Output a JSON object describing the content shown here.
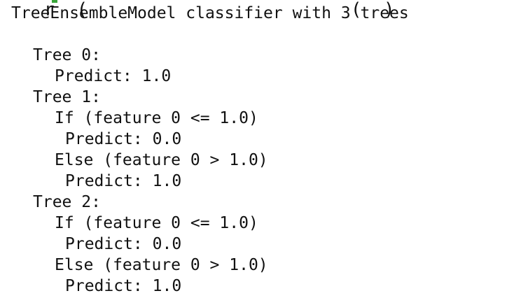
{
  "clipped_line": "  r  (                        (  )",
  "output": {
    "header": "TreeEnsembleModel classifier with 3 trees",
    "lines": [
      "Tree 0:",
      "Predict: 1.0",
      "Tree 1:",
      "If (feature 0 <= 1.0)",
      "Predict: 0.0",
      "Else (feature 0 > 1.0)",
      "Predict: 1.0",
      "Tree 2:",
      "If (feature 0 <= 1.0)",
      "Predict: 0.0",
      "Else (feature 0 > 1.0)",
      "Predict: 1.0"
    ]
  },
  "colors": {
    "text": "#111111",
    "background": "#ffffff",
    "clipped_accent": "#3aa53a"
  }
}
